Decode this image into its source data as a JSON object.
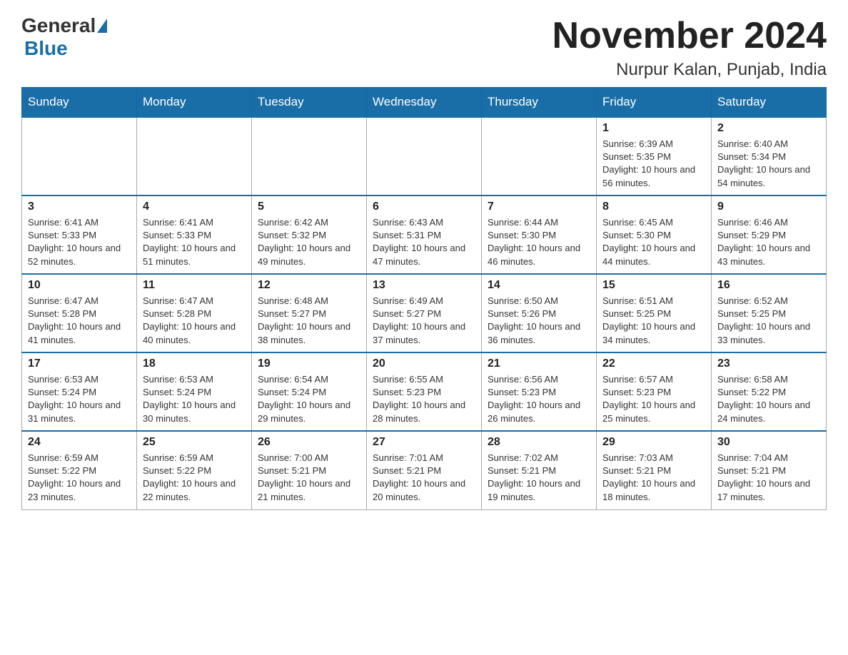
{
  "header": {
    "logo_general": "General",
    "logo_blue": "Blue",
    "month": "November 2024",
    "location": "Nurpur Kalan, Punjab, India"
  },
  "days_of_week": [
    "Sunday",
    "Monday",
    "Tuesday",
    "Wednesday",
    "Thursday",
    "Friday",
    "Saturday"
  ],
  "weeks": [
    [
      {
        "day": "",
        "info": ""
      },
      {
        "day": "",
        "info": ""
      },
      {
        "day": "",
        "info": ""
      },
      {
        "day": "",
        "info": ""
      },
      {
        "day": "",
        "info": ""
      },
      {
        "day": "1",
        "info": "Sunrise: 6:39 AM\nSunset: 5:35 PM\nDaylight: 10 hours and 56 minutes."
      },
      {
        "day": "2",
        "info": "Sunrise: 6:40 AM\nSunset: 5:34 PM\nDaylight: 10 hours and 54 minutes."
      }
    ],
    [
      {
        "day": "3",
        "info": "Sunrise: 6:41 AM\nSunset: 5:33 PM\nDaylight: 10 hours and 52 minutes."
      },
      {
        "day": "4",
        "info": "Sunrise: 6:41 AM\nSunset: 5:33 PM\nDaylight: 10 hours and 51 minutes."
      },
      {
        "day": "5",
        "info": "Sunrise: 6:42 AM\nSunset: 5:32 PM\nDaylight: 10 hours and 49 minutes."
      },
      {
        "day": "6",
        "info": "Sunrise: 6:43 AM\nSunset: 5:31 PM\nDaylight: 10 hours and 47 minutes."
      },
      {
        "day": "7",
        "info": "Sunrise: 6:44 AM\nSunset: 5:30 PM\nDaylight: 10 hours and 46 minutes."
      },
      {
        "day": "8",
        "info": "Sunrise: 6:45 AM\nSunset: 5:30 PM\nDaylight: 10 hours and 44 minutes."
      },
      {
        "day": "9",
        "info": "Sunrise: 6:46 AM\nSunset: 5:29 PM\nDaylight: 10 hours and 43 minutes."
      }
    ],
    [
      {
        "day": "10",
        "info": "Sunrise: 6:47 AM\nSunset: 5:28 PM\nDaylight: 10 hours and 41 minutes."
      },
      {
        "day": "11",
        "info": "Sunrise: 6:47 AM\nSunset: 5:28 PM\nDaylight: 10 hours and 40 minutes."
      },
      {
        "day": "12",
        "info": "Sunrise: 6:48 AM\nSunset: 5:27 PM\nDaylight: 10 hours and 38 minutes."
      },
      {
        "day": "13",
        "info": "Sunrise: 6:49 AM\nSunset: 5:27 PM\nDaylight: 10 hours and 37 minutes."
      },
      {
        "day": "14",
        "info": "Sunrise: 6:50 AM\nSunset: 5:26 PM\nDaylight: 10 hours and 36 minutes."
      },
      {
        "day": "15",
        "info": "Sunrise: 6:51 AM\nSunset: 5:25 PM\nDaylight: 10 hours and 34 minutes."
      },
      {
        "day": "16",
        "info": "Sunrise: 6:52 AM\nSunset: 5:25 PM\nDaylight: 10 hours and 33 minutes."
      }
    ],
    [
      {
        "day": "17",
        "info": "Sunrise: 6:53 AM\nSunset: 5:24 PM\nDaylight: 10 hours and 31 minutes."
      },
      {
        "day": "18",
        "info": "Sunrise: 6:53 AM\nSunset: 5:24 PM\nDaylight: 10 hours and 30 minutes."
      },
      {
        "day": "19",
        "info": "Sunrise: 6:54 AM\nSunset: 5:24 PM\nDaylight: 10 hours and 29 minutes."
      },
      {
        "day": "20",
        "info": "Sunrise: 6:55 AM\nSunset: 5:23 PM\nDaylight: 10 hours and 28 minutes."
      },
      {
        "day": "21",
        "info": "Sunrise: 6:56 AM\nSunset: 5:23 PM\nDaylight: 10 hours and 26 minutes."
      },
      {
        "day": "22",
        "info": "Sunrise: 6:57 AM\nSunset: 5:23 PM\nDaylight: 10 hours and 25 minutes."
      },
      {
        "day": "23",
        "info": "Sunrise: 6:58 AM\nSunset: 5:22 PM\nDaylight: 10 hours and 24 minutes."
      }
    ],
    [
      {
        "day": "24",
        "info": "Sunrise: 6:59 AM\nSunset: 5:22 PM\nDaylight: 10 hours and 23 minutes."
      },
      {
        "day": "25",
        "info": "Sunrise: 6:59 AM\nSunset: 5:22 PM\nDaylight: 10 hours and 22 minutes."
      },
      {
        "day": "26",
        "info": "Sunrise: 7:00 AM\nSunset: 5:21 PM\nDaylight: 10 hours and 21 minutes."
      },
      {
        "day": "27",
        "info": "Sunrise: 7:01 AM\nSunset: 5:21 PM\nDaylight: 10 hours and 20 minutes."
      },
      {
        "day": "28",
        "info": "Sunrise: 7:02 AM\nSunset: 5:21 PM\nDaylight: 10 hours and 19 minutes."
      },
      {
        "day": "29",
        "info": "Sunrise: 7:03 AM\nSunset: 5:21 PM\nDaylight: 10 hours and 18 minutes."
      },
      {
        "day": "30",
        "info": "Sunrise: 7:04 AM\nSunset: 5:21 PM\nDaylight: 10 hours and 17 minutes."
      }
    ]
  ]
}
